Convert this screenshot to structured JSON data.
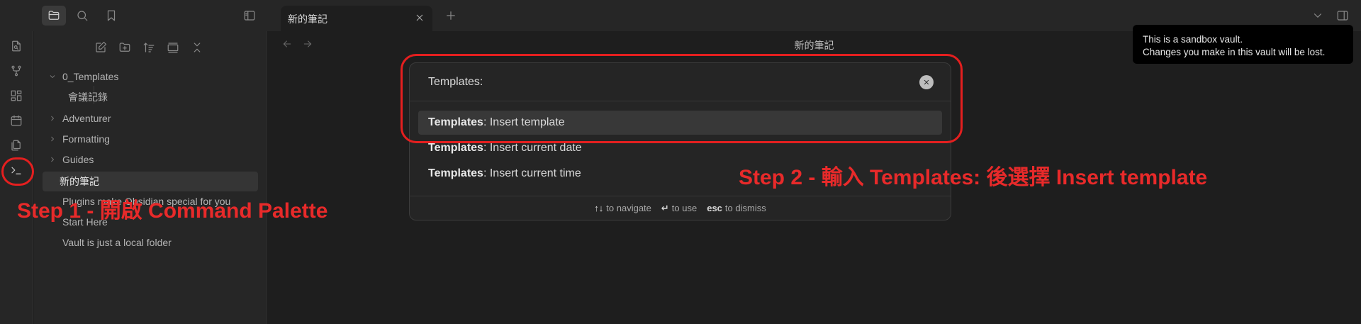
{
  "tab": {
    "title": "新的筆記"
  },
  "view": {
    "title": "新的筆記"
  },
  "tooltip": {
    "line1": "This is a sandbox vault.",
    "line2": "Changes you make in this vault will be lost."
  },
  "sidebar": {
    "items": [
      {
        "label": "0_Templates",
        "type": "folder-open"
      },
      {
        "label": "會議記錄",
        "type": "file-nested"
      },
      {
        "label": "Adventurer",
        "type": "folder"
      },
      {
        "label": "Formatting",
        "type": "folder"
      },
      {
        "label": "Guides",
        "type": "folder"
      },
      {
        "label": "新的筆記",
        "type": "file",
        "selected": true
      },
      {
        "label": "Plugins make Obsidian special for you",
        "type": "file"
      },
      {
        "label": "Start Here",
        "type": "file"
      },
      {
        "label": "Vault is just a local folder",
        "type": "file"
      }
    ]
  },
  "palette": {
    "query": "Templates:",
    "suggestions": [
      {
        "prefix": "Templates",
        "rest": ": Insert template",
        "selected": true
      },
      {
        "prefix": "Templates",
        "rest": ": Insert current date"
      },
      {
        "prefix": "Templates",
        "rest": ": Insert current time"
      }
    ],
    "footer": [
      {
        "key": "↑↓",
        "text": "to navigate"
      },
      {
        "key": "↵",
        "text": "to use"
      },
      {
        "key": "esc",
        "text": "to dismiss"
      }
    ]
  },
  "annotations": {
    "step1": "Step 1 - 開啟 Command Palette",
    "step2": "Step 2 - 輸入 Templates: 後選擇 Insert template",
    "color": "#e82a2a"
  }
}
